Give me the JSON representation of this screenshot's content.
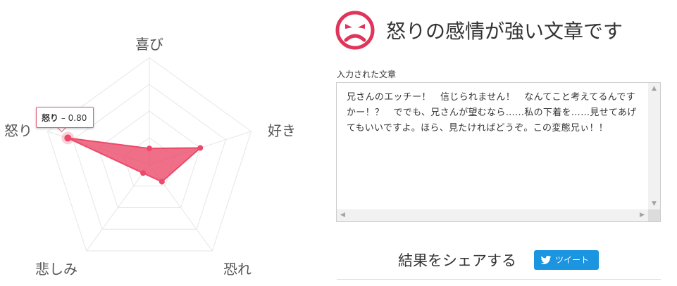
{
  "radar": {
    "labels": {
      "joy": "喜び",
      "like": "好き",
      "fear": "恐れ",
      "sadness": "悲しみ",
      "anger": "怒り"
    },
    "tooltip": {
      "label": "怒り",
      "value": "– 0.80"
    },
    "colors": {
      "fill": "#eb4b6a",
      "grid": "#e6e6e6"
    }
  },
  "chart_data": {
    "type": "radar",
    "categories": [
      "喜び",
      "好き",
      "恐れ",
      "悲しみ",
      "怒り"
    ],
    "values": [
      0.15,
      0.5,
      0.2,
      0.1,
      0.8
    ],
    "rmax": 1.0
  },
  "result": {
    "icon": "angry-face-icon",
    "title": "怒りの感情が強い文章です",
    "accent": "#e0345a"
  },
  "input": {
    "label": "入力された文章",
    "text": "兄さんのエッチー！　信じられません！　なんてこと考えてるんですかー！？　ででも、兄さんが望むなら……私の下着を……見せてあげてもいいですよ。ほら、見たければどうぞ。この変態兄ぃ！！"
  },
  "share": {
    "text": "結果をシェアする",
    "tweet_label": "ツイート",
    "tweet_color": "#1b95e0"
  }
}
